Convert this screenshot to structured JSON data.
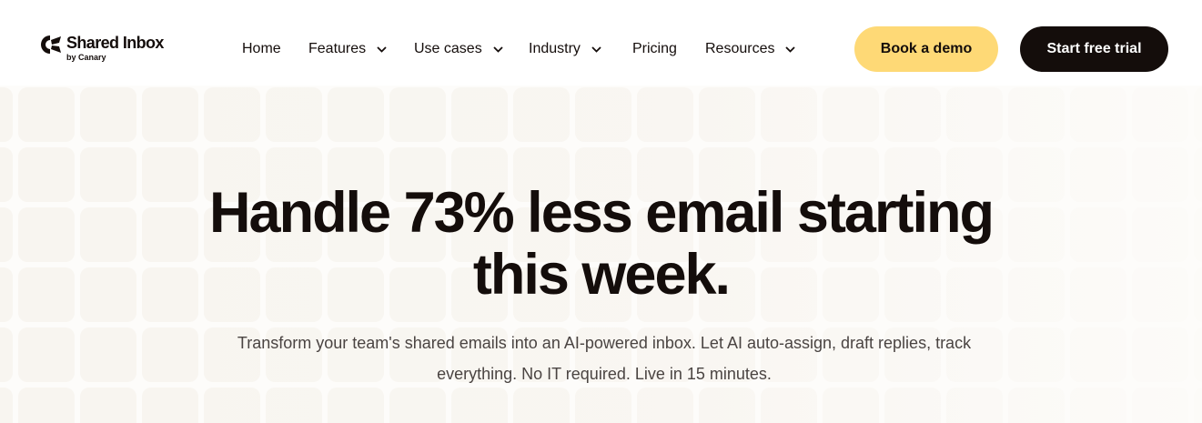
{
  "brand": {
    "name": "Shared Inbox",
    "byline": "by Canary"
  },
  "nav": {
    "items": [
      {
        "label": "Home",
        "has_dropdown": false
      },
      {
        "label": "Features",
        "has_dropdown": true
      },
      {
        "label": "Use cases",
        "has_dropdown": true
      },
      {
        "label": "Industry",
        "has_dropdown": true
      },
      {
        "label": "Pricing",
        "has_dropdown": false
      },
      {
        "label": "Resources",
        "has_dropdown": true
      }
    ]
  },
  "actions": {
    "demo_label": "Book a demo",
    "trial_label": "Start free trial"
  },
  "hero": {
    "headline_line1": "Handle 73% less email starting",
    "headline_line2": "this week.",
    "subtitle_line1": "Transform your team's shared emails into an AI-powered inbox. Let AI auto-assign, draft replies, track",
    "subtitle_line2": "everything. No IT required. Live in 15 minutes."
  },
  "colors": {
    "ink": "#140d0b",
    "accent_yellow": "#fed976",
    "hero_bg": "#fdfcfa",
    "subtitle_text": "#4a4442"
  },
  "icons": {
    "logo": "canary-logo-mark",
    "dropdown": "chevron-down-icon"
  }
}
